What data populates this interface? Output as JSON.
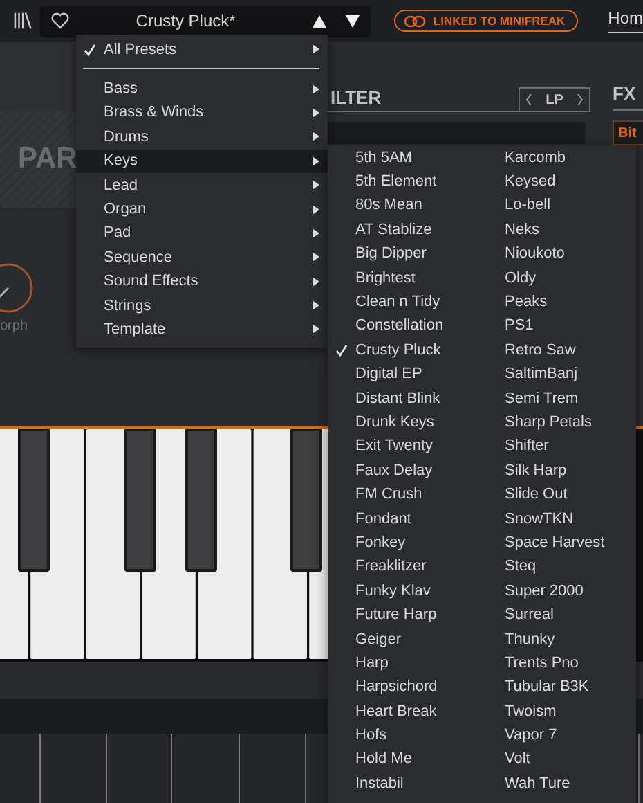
{
  "top_bar": {
    "preset_name": "Crusty Pluck*",
    "link_button": "LINKED TO MINIFREAK",
    "tab": "Hom"
  },
  "background": {
    "panel_title": "PAR",
    "knob_label": "orph",
    "filter_title": "ILTER",
    "filter_mode": "LP",
    "fx_title": "FX",
    "fx_slot": "Bit"
  },
  "preset_menu": {
    "all_item": {
      "label": "All Presets",
      "checked": true
    },
    "categories": [
      {
        "label": "Bass",
        "selected": false
      },
      {
        "label": "Brass & Winds",
        "selected": false
      },
      {
        "label": "Drums",
        "selected": false
      },
      {
        "label": "Keys",
        "selected": true
      },
      {
        "label": "Lead",
        "selected": false
      },
      {
        "label": "Organ",
        "selected": false
      },
      {
        "label": "Pad",
        "selected": false
      },
      {
        "label": "Sequence",
        "selected": false
      },
      {
        "label": "Sound Effects",
        "selected": false
      },
      {
        "label": "Strings",
        "selected": false
      },
      {
        "label": "Template",
        "selected": false
      }
    ]
  },
  "keys_submenu": [
    {
      "label": "5th 5AM",
      "checked": false
    },
    {
      "label": "5th Element",
      "checked": false
    },
    {
      "label": "80s Mean",
      "checked": false
    },
    {
      "label": "AT Stablize",
      "checked": false
    },
    {
      "label": "Big Dipper",
      "checked": false
    },
    {
      "label": "Brightest",
      "checked": false
    },
    {
      "label": "Clean n Tidy",
      "checked": false
    },
    {
      "label": "Constellation",
      "checked": false
    },
    {
      "label": "Crusty Pluck",
      "checked": true
    },
    {
      "label": "Digital EP",
      "checked": false
    },
    {
      "label": "Distant Blink",
      "checked": false
    },
    {
      "label": "Drunk Keys",
      "checked": false
    },
    {
      "label": "Exit Twenty",
      "checked": false
    },
    {
      "label": "Faux Delay",
      "checked": false
    },
    {
      "label": "FM Crush",
      "checked": false
    },
    {
      "label": "Fondant",
      "checked": false
    },
    {
      "label": "Fonkey",
      "checked": false
    },
    {
      "label": "Freaklitzer",
      "checked": false
    },
    {
      "label": "Funky Klav",
      "checked": false
    },
    {
      "label": "Future Harp",
      "checked": false
    },
    {
      "label": "Geiger",
      "checked": false
    },
    {
      "label": "Harp",
      "checked": false
    },
    {
      "label": "Harpsichord",
      "checked": false
    },
    {
      "label": "Heart Break",
      "checked": false
    },
    {
      "label": "Hofs",
      "checked": false
    },
    {
      "label": "Hold Me",
      "checked": false
    },
    {
      "label": "Instabil",
      "checked": false
    },
    {
      "label": "Karcomb",
      "checked": false
    },
    {
      "label": "Keysed",
      "checked": false
    },
    {
      "label": "Lo-bell",
      "checked": false
    },
    {
      "label": "Neks",
      "checked": false
    },
    {
      "label": "Nioukoto",
      "checked": false
    },
    {
      "label": "Oldy",
      "checked": false
    },
    {
      "label": "Peaks",
      "checked": false
    },
    {
      "label": "PS1",
      "checked": false
    },
    {
      "label": "Retro Saw",
      "checked": false
    },
    {
      "label": "SaltimBanj",
      "checked": false
    },
    {
      "label": "Semi Trem",
      "checked": false
    },
    {
      "label": "Sharp Petals",
      "checked": false
    },
    {
      "label": "Shifter",
      "checked": false
    },
    {
      "label": "Silk Harp",
      "checked": false
    },
    {
      "label": "Slide Out",
      "checked": false
    },
    {
      "label": "SnowTKN",
      "checked": false
    },
    {
      "label": "Space Harvest",
      "checked": false
    },
    {
      "label": "Steq",
      "checked": false
    },
    {
      "label": "Super 2000",
      "checked": false
    },
    {
      "label": "Surreal",
      "checked": false
    },
    {
      "label": "Thunky",
      "checked": false
    },
    {
      "label": "Trents Pno",
      "checked": false
    },
    {
      "label": "Tubular B3K",
      "checked": false
    },
    {
      "label": "Twoism",
      "checked": false
    },
    {
      "label": "Vapor 7",
      "checked": false
    },
    {
      "label": "Volt",
      "checked": false
    },
    {
      "label": "Wah Ture",
      "checked": false
    }
  ]
}
